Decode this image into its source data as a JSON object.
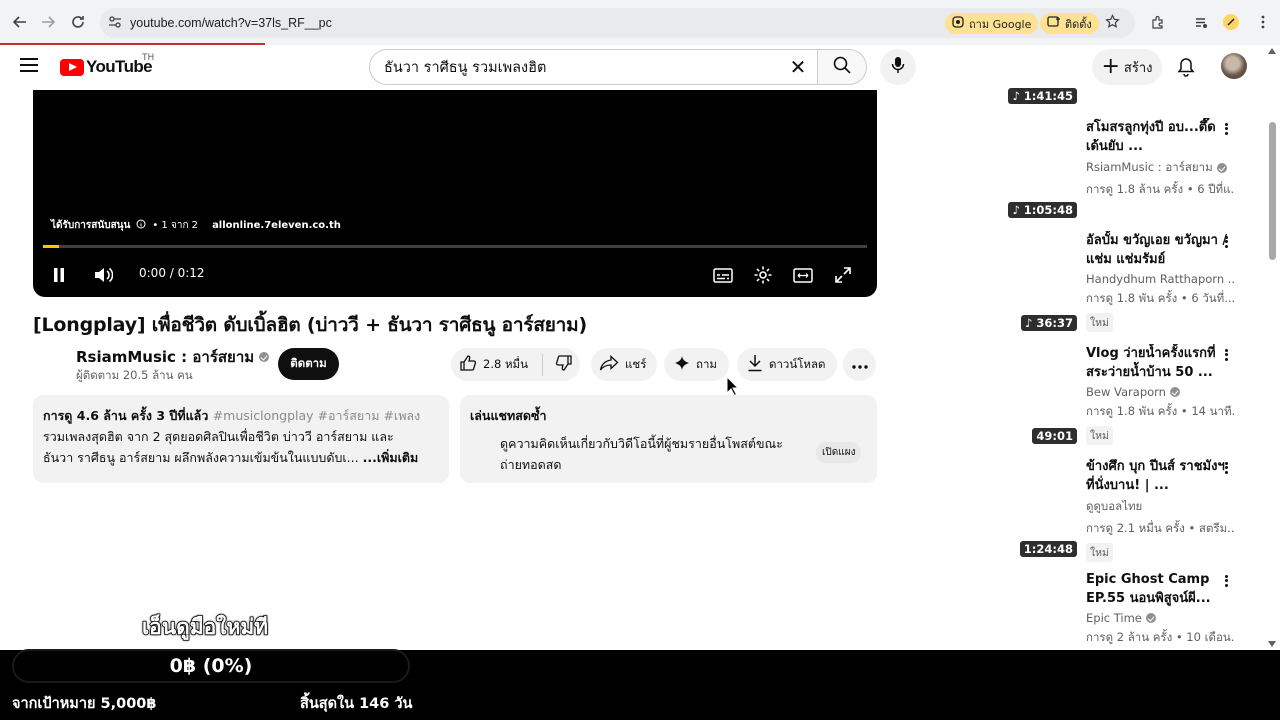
{
  "browser": {
    "url": "youtube.com/watch?v=37ls_RF__pc",
    "chip_ask_google": "ถาม Google",
    "chip_install": "ติดตั้ง"
  },
  "header": {
    "logo_text": "YouTube",
    "region": "TH",
    "search_query": "ธันวา ราศีธนู รวมเพลงฮิต",
    "create_label": "สร้าง"
  },
  "player": {
    "ad_label": "ได้รับการสนับสนุน",
    "ad_count": "• 1 จาก 2",
    "ad_domain": "allonline.7eleven.co.th",
    "time": "0:00 / 0:12",
    "progress": 0.02
  },
  "video": {
    "title": "[Longplay] เพื่อชีวิต ดับเบิ้ลฮิต (บ่าววี + ธันวา ราศีธนู อาร์สยาม)",
    "channel": "RsiamMusic : อาร์สยาม",
    "subscribers": "ผู้ติดตาม 20.5 ล้าน คน",
    "subscribe_label": "ติดตาม",
    "likes": "2.8 หมื่น",
    "share_label": "แชร์",
    "ask_label": "ถาม",
    "download_label": "ดาวน์โหลด"
  },
  "description": {
    "stats": "การดู 4.6 ล้าน ครั้ง  3 ปีที่แล้ว",
    "tags": "#musiclongplay #อาร์สยาม #เพลง",
    "line1": "รวมเพลงสุดฮิต จาก 2 สุดยอดศิลปินเพื่อชีวิต บ่าววี อาร์สยาม และ",
    "line2": "ธันวา ราศีธนู อาร์สยาม ผลึกพลังความเข้มข้นในแบบดับเ...",
    "more": "...เพิ่มเติม"
  },
  "chat": {
    "title": "เล่นแชทสดซ้ำ",
    "body": "ดูความคิดเห็นเกี่ยวกับวิดีโอนี้ที่ผู้ชมรายอื่นโพสต์ขณะถ่ายทอดสด",
    "open_label": "เปิดแผง"
  },
  "sidebar": {
    "top_duration": "1:41:45",
    "items": [
      {
        "title": "สโมสรลูกทุ่งปี อบ...ตึ๊ด เด้นยับ ...",
        "channel": "RsiamMusic : อาร์สยาม",
        "verified": true,
        "meta": "การดู 1.8 ล้าน ครั้ง • 6 ปีที่แ...",
        "duration": "1:05:48",
        "new": ""
      },
      {
        "title": "อัลบั้ม ขวัญเอย ขวัญมา / แช่ม แช่มรัมย์",
        "channel": "Handydhum Ratthaporn ...",
        "verified": false,
        "meta": "การดู 1.8 พัน ครั้ง • 6 วันที่...",
        "duration": "36:37",
        "new": "ใหม่"
      },
      {
        "title": "Vlog ว่ายน้ำครั้งแรกที่สระว่ายน้ำบ้าน 50 ...",
        "channel": "Bew Varaporn",
        "verified": true,
        "meta": "การดู 1.8 พัน ครั้ง • 14 นาที...",
        "duration": "49:01",
        "new": "ใหม่"
      },
      {
        "title": "ข้างศึก บุก ปีนส์ ราชมังฯ ที่นั่งบาน! | ...",
        "channel": "ดูดูบอลไทย",
        "verified": false,
        "meta": "การดู 2.1 หมื่น ครั้ง • สตรีม...",
        "duration": "1:24:48",
        "new": "ใหม่"
      },
      {
        "title": "Epic Ghost Camp EP.55 นอนพิสูจน์ผี...",
        "channel": "Epic Time",
        "verified": true,
        "meta": "การดู 2 ล้าน ครั้ง • 10 เดือน...",
        "duration": "",
        "new": ""
      }
    ]
  },
  "overlay": {
    "caption": "เอ็นดูมือใหม่ที",
    "amount": "0฿ (0%)",
    "goal": "จากเป้าหมาย 5,000฿",
    "ends": "สิ้นสุดใน 146 วัน",
    "progress": 0
  }
}
